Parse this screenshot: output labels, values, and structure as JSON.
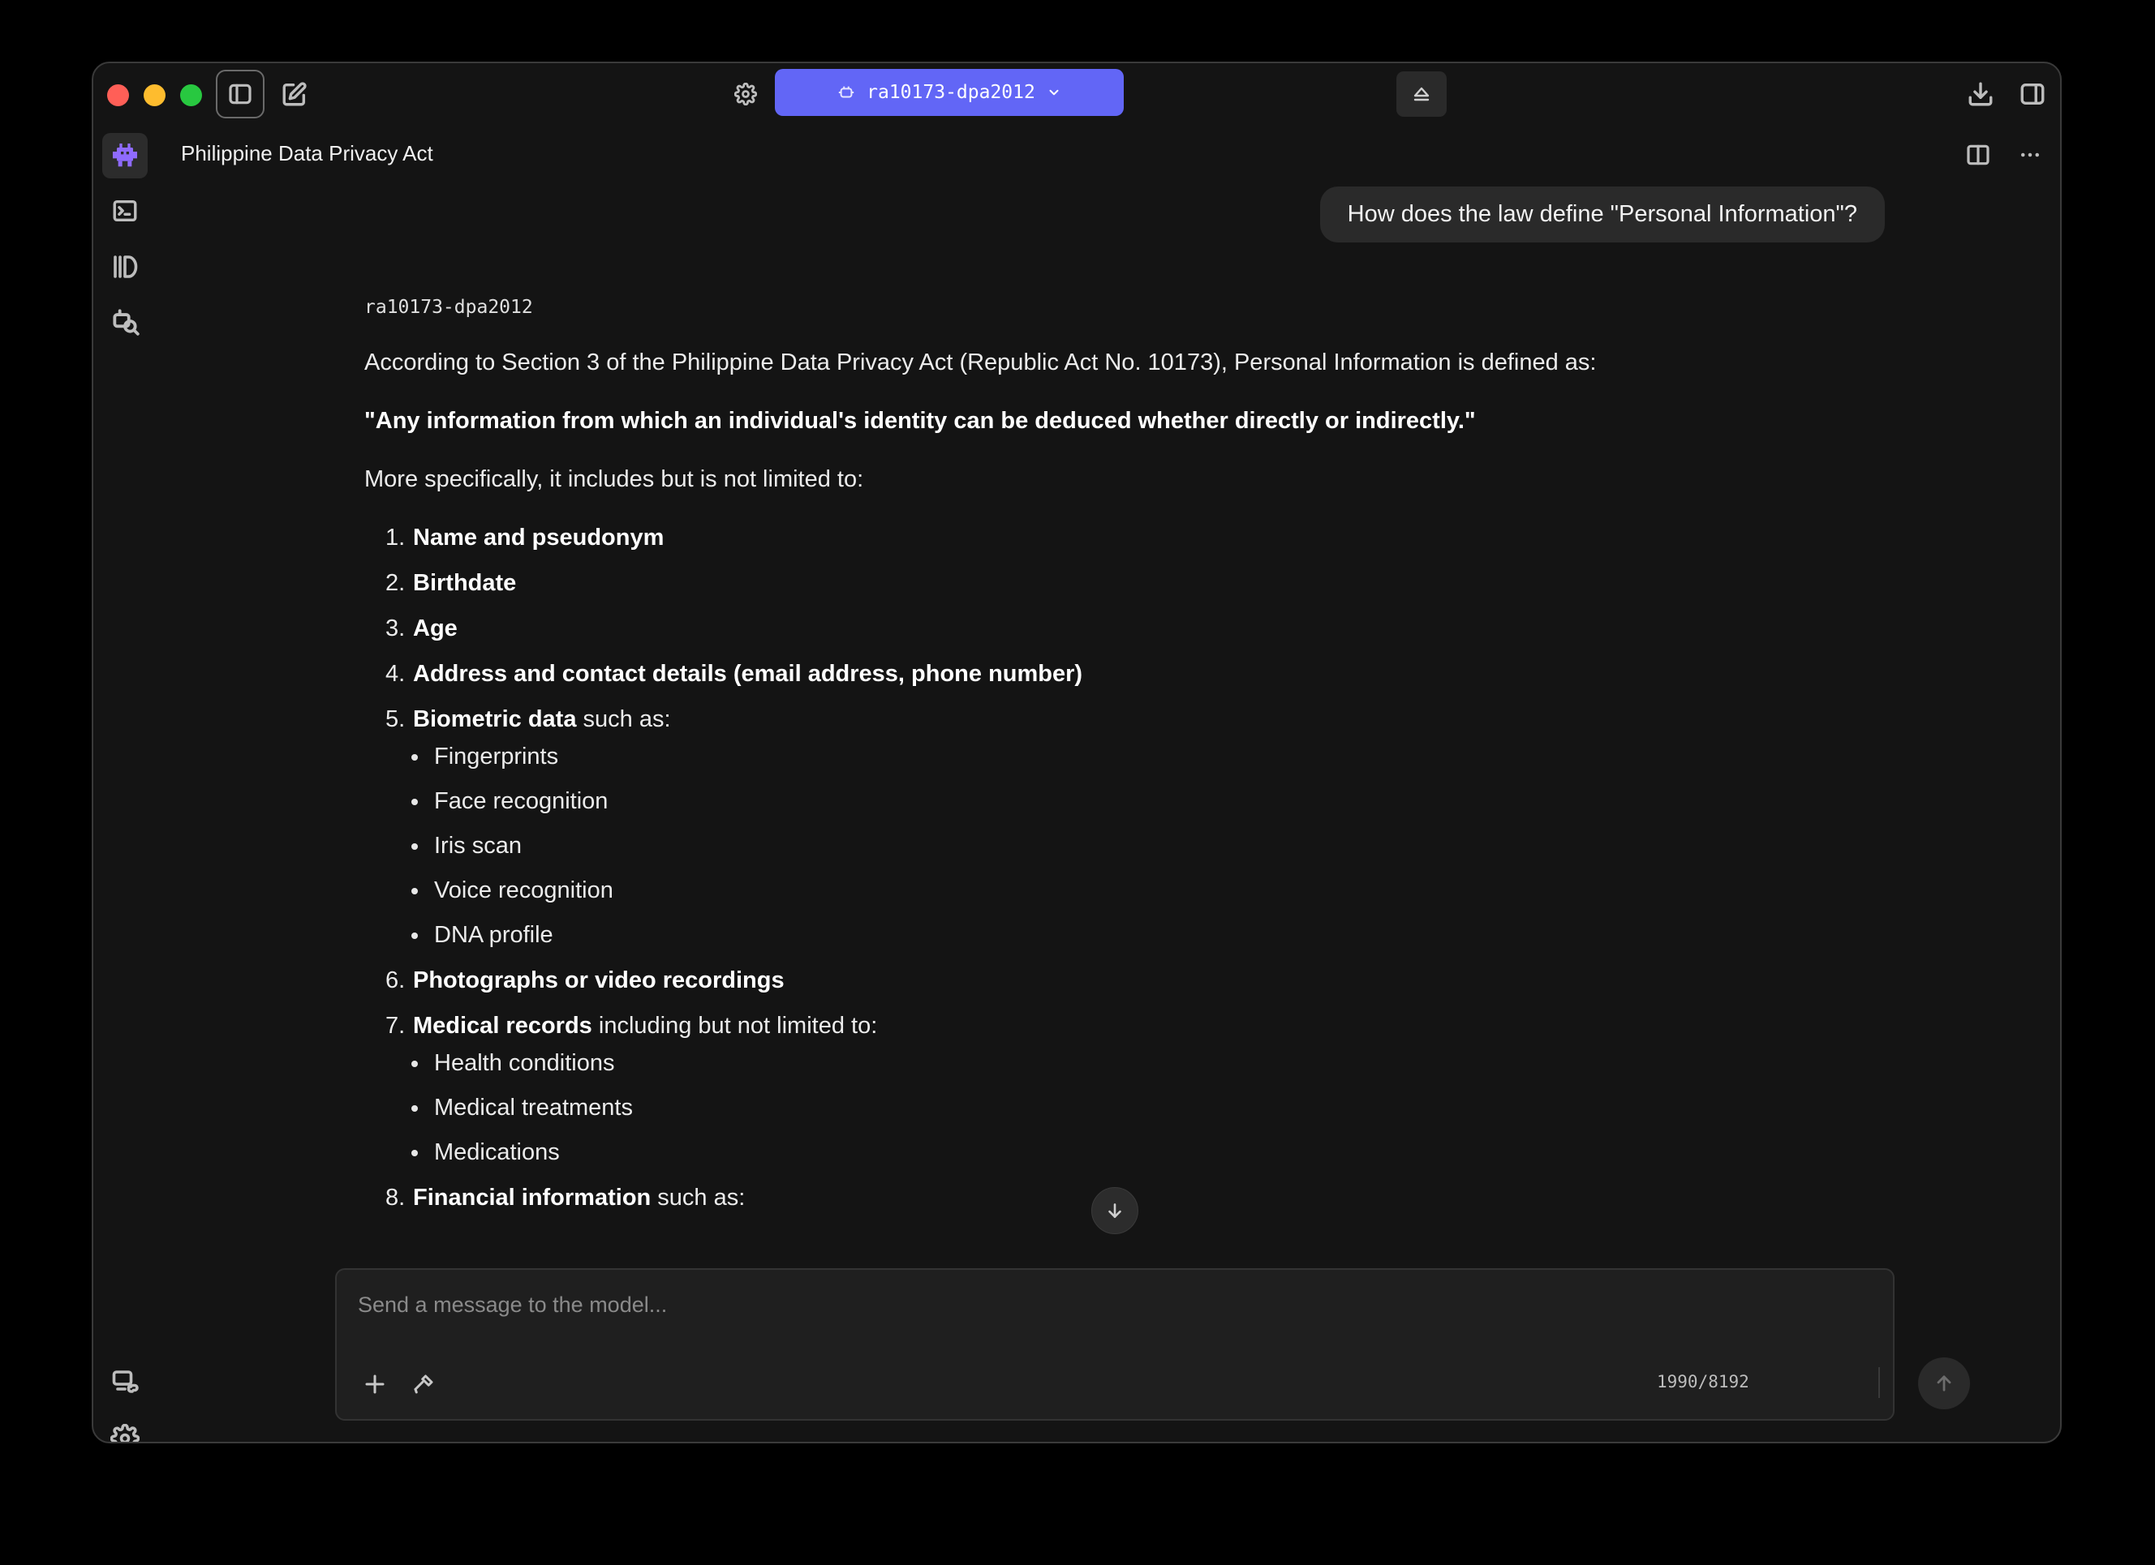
{
  "header": {
    "model_name": "ra10173-dpa2012",
    "chat_title": "Philippine Data Privacy Act"
  },
  "conversation": {
    "user_message": "How does the law define \"Personal Information\"?",
    "assistant": {
      "source": "ra10173-dpa2012",
      "intro": "According to Section 3 of the Philippine Data Privacy Act (Republic Act No. 10173), Personal Information is defined as:",
      "definition": "\"Any information from which an individual's identity can be deduced whether directly or indirectly.\"",
      "lead": "More specifically, it includes but is not limited to:",
      "items": [
        {
          "num": "1.",
          "bold": "Name and pseudonym",
          "rest": ""
        },
        {
          "num": "2.",
          "bold": "Birthdate",
          "rest": ""
        },
        {
          "num": "3.",
          "bold": "Age",
          "rest": ""
        },
        {
          "num": "4.",
          "bold": "Address and contact details (email address, phone number)",
          "rest": ""
        },
        {
          "num": "5.",
          "bold": "Biometric data",
          "rest": " such as:",
          "sub": [
            "Fingerprints",
            "Face recognition",
            "Iris scan",
            "Voice recognition",
            "DNA profile"
          ]
        },
        {
          "num": "6.",
          "bold": "Photographs or video recordings",
          "rest": ""
        },
        {
          "num": "7.",
          "bold": "Medical records",
          "rest": " including but not limited to:",
          "sub": [
            "Health conditions",
            "Medical treatments",
            "Medications"
          ]
        },
        {
          "num": "8.",
          "bold": "Financial information",
          "rest": " such as:"
        }
      ]
    }
  },
  "composer": {
    "placeholder": "Send a message to the model...",
    "token_count": "1990/8192"
  }
}
